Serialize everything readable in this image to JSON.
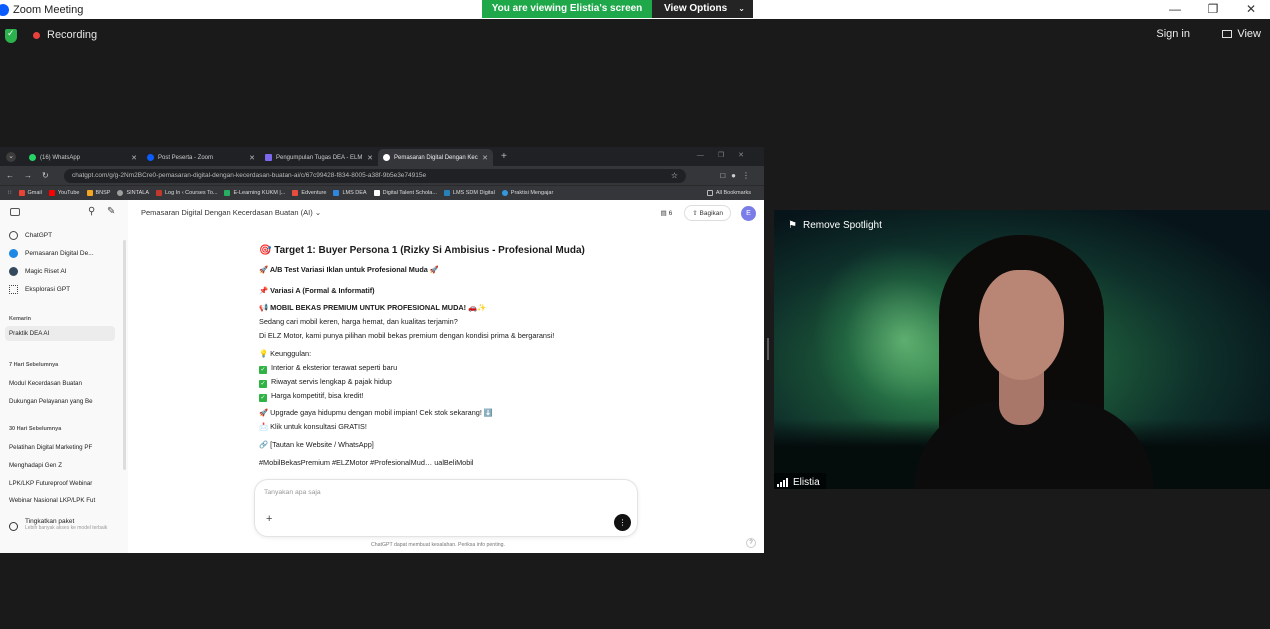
{
  "window": {
    "title": "Zoom Meeting"
  },
  "banner": {
    "viewing_text": "You are viewing Elistia's screen",
    "view_options": "View Options"
  },
  "toolbar": {
    "recording": "Recording",
    "sign_in": "Sign in",
    "view": "View"
  },
  "browser": {
    "tabs": [
      {
        "label": "(16) WhatsApp",
        "color": "#25d366"
      },
      {
        "label": "Post Peserta - Zoom",
        "color": "#0b5cff"
      },
      {
        "label": "Pengumpulan Tugas DEA - ELM",
        "color": "#7b68ee"
      },
      {
        "label": "Pemasaran Digital Dengan Kec",
        "color": "#ffffff"
      }
    ],
    "url": "chatgpt.com/g/g-2Nm2BCre0-pemasaran-digital-dengan-kecerdasan-buatan-ai/c/67c99428-f834-8005-a38f-9b5e3e74915e",
    "bookmarks": [
      {
        "label": "Gmail",
        "color": "#ea4335"
      },
      {
        "label": "YouTube",
        "color": "#ff0000"
      },
      {
        "label": "BNSP",
        "color": "#f5a623"
      },
      {
        "label": "SINTALA",
        "color": "#9e9e9e"
      },
      {
        "label": "Log In ‹ Courses To...",
        "color": "#c0392b"
      },
      {
        "label": "E-Learning KUKM |...",
        "color": "#27ae60"
      },
      {
        "label": "Edventure",
        "color": "#e74c3c"
      },
      {
        "label": "LMS DEA",
        "color": "#2e86de"
      },
      {
        "label": "Digital Talent Schola...",
        "color": "#ffffff"
      },
      {
        "label": "LMS SDM Digital",
        "color": "#2980b9"
      },
      {
        "label": "Praktisi Mengajar",
        "color": "#3498db"
      }
    ],
    "all_bookmarks": "All Bookmarks"
  },
  "sidebar": {
    "items": [
      {
        "label": "ChatGPT"
      },
      {
        "label": "Pemasaran Digital De..."
      },
      {
        "label": "Magic Riset AI"
      },
      {
        "label": "Eksplorasi GPT"
      }
    ],
    "sections": [
      {
        "title": "Kemarin",
        "history": [
          "Praktik DEA AI"
        ]
      },
      {
        "title": "7 Hari Sebelumnya",
        "history": [
          "Modul Kecerdasan Buatan",
          "Dukungan Pelayanan yang Be"
        ]
      },
      {
        "title": "30 Hari Sebelumnya",
        "history": [
          "Pelatihan Digital Marketing PF",
          "Menghadapi Gen Z",
          "LPK/LKP Futureproof Webinar",
          "Webinar Nasional LKP/LPK Fut"
        ]
      }
    ],
    "upgrade_title": "Tingkatkan paket",
    "upgrade_sub": "Lebih banyak akses ke model terbaik"
  },
  "chat": {
    "title": "Pemasaran Digital Dengan Kecerdasan Buatan (AI)",
    "doc_count": "6",
    "share": "Bagikan",
    "avatar": "E",
    "lines": [
      "🎯 Target 1: Buyer Persona 1 (Rizky Si Ambisius - Profesional Muda)",
      "🚀 A/B Test Variasi Iklan untuk Profesional Muda 🚀",
      "📌 Variasi A (Formal & Informatif)",
      "📢 MOBIL BEKAS PREMIUM UNTUK PROFESIONAL MUDA! 🚗✨",
      "Sedang cari mobil keren, harga hemat, dan kualitas terjamin?",
      "Di ELZ Motor, kami punya pilihan mobil bekas premium dengan kondisi prima & bergaransi!",
      "💡 Keunggulan:",
      "Interior & eksterior terawat seperti baru",
      "Riwayat servis lengkap & pajak hidup",
      "Harga kompetitif, bisa kredit!",
      "🚀 Upgrade gaya hidupmu dengan mobil impian! Cek stok sekarang! ⬇️",
      "📩 Klik untuk konsultasi GRATIS!",
      "🔗 [Tautan ke Website / WhatsApp]",
      "#MobilBekasPremium #ELZMotor #ProfesionalMud… ualBeliMobil"
    ],
    "composer_placeholder": "Tanyakan apa saja",
    "disclaimer": "ChatGPT dapat membuat kesalahan. Periksa info penting.",
    "help": "?"
  },
  "video": {
    "spotlight": "Remove Spotlight",
    "name": "Elistia"
  }
}
